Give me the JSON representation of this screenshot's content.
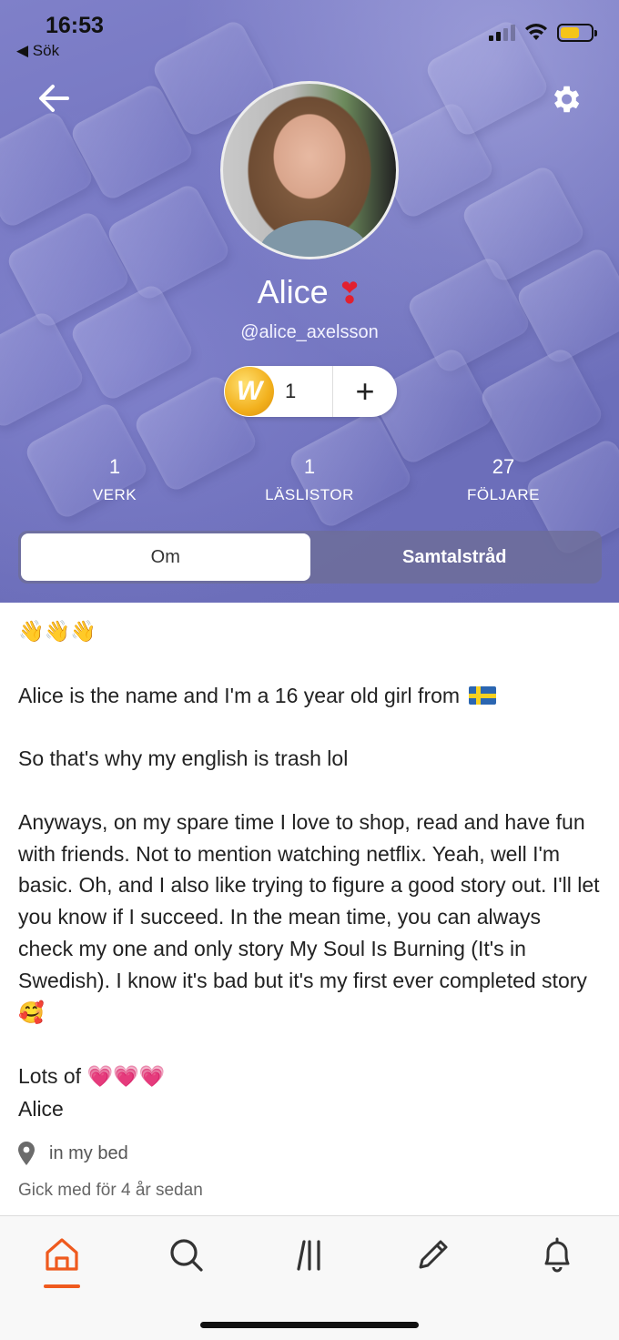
{
  "status_bar": {
    "time": "16:53",
    "back_label": "◀ Sök",
    "battery_color": "#f5c518"
  },
  "header": {
    "back_icon": "arrow-left-icon",
    "settings_icon": "gear-icon"
  },
  "profile": {
    "name": "Alice",
    "heart": "❣",
    "handle": "@alice_axelsson",
    "coin_count": "1",
    "coin_symbol": "W",
    "add_symbol": "+"
  },
  "stats": [
    {
      "value": "1",
      "label": "VERK"
    },
    {
      "value": "1",
      "label": "LÄSLISTOR"
    },
    {
      "value": "27",
      "label": "FÖLJARE"
    }
  ],
  "tabs": {
    "about": "Om",
    "conversations": "Samtalstråd"
  },
  "bio": {
    "wave_emojis": "👋👋👋",
    "line1": "Alice is the name and I'm a 16 year old girl from",
    "line2": "So that's why my english is trash lol",
    "paragraph3": "Anyways, on my spare time I love to shop, read and have fun with friends. Not to mention watching netflix. Yeah, well I'm basic. Oh, and I also like trying to figure a good story out. I'll let you know if I succeed. In the mean time, you can always check my one and only story My Soul Is Burning (It's in Swedish). I know it's bad but it's my first ever completed story",
    "paragraph3_emoji": "🥰",
    "closing": "Lots of",
    "closing_emojis": "💗💗💗",
    "signature": "Alice"
  },
  "location": "in my bed",
  "joined": "Gick med för 4 år sedan",
  "bottom_nav": {
    "active": "home",
    "accent_color": "#ef5a1e",
    "items": [
      "home-icon",
      "search-icon",
      "library-icon",
      "write-icon",
      "notifications-icon"
    ]
  }
}
